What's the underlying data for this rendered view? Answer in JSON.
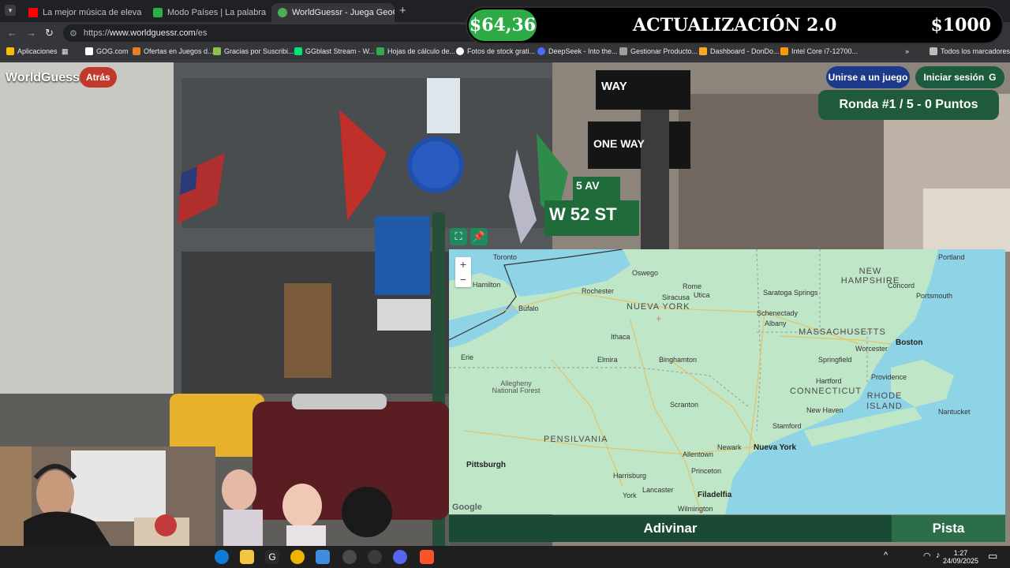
{
  "browser": {
    "tabs": [
      {
        "title": "La mejor música de elevac",
        "color": "#ff0000"
      },
      {
        "title": "Modo Países | La palabra del dí",
        "color": "#2eaa46"
      },
      {
        "title": "WorldGuessr - Juega GeoGuess",
        "color": "#4caf50"
      }
    ],
    "url_scheme": "https://",
    "url_host": "www.worldguessr.com",
    "url_path": "/es",
    "bookmarks": [
      "Aplicaciones",
      "GOG.com",
      "Ofertas en Juegos d...",
      "Gracias por Suscribi...",
      "GGblast Stream - W...",
      "Hojas de cálculo de...",
      "Fotos de stock grati...",
      "DeepSeek - Into the...",
      "Gestionar Producto...",
      "Dashboard - DonDo...",
      "Intel Core i7-12700..."
    ],
    "all_bookmarks": "Todos los marcadores"
  },
  "banner": {
    "left": "$64,36",
    "middle": "ACTUALIZACIÓN 2.0",
    "right": "$1000"
  },
  "game": {
    "logo": "WorldGuessr",
    "back": "Atrás",
    "join": "Unirse a un juego",
    "login": "Iniciar sesión",
    "login_icon": "G",
    "round": "Ronda #1 / 5 - 0 Puntos",
    "guess": "Adivinar",
    "hint": "Pista"
  },
  "street_signs": {
    "one_way": "ONE WAY",
    "way": "WAY",
    "street": "W 52 ST",
    "avenue": "5 AV"
  },
  "map": {
    "zoom_in": "+",
    "zoom_out": "−",
    "google": "Google",
    "cities": {
      "toronto": "Toronto",
      "hamilton": "Hamilton",
      "bufalo": "Búfalo",
      "rochester": "Rochester",
      "siracusa": "Siracusa",
      "albany": "Albany",
      "boston": "Boston",
      "portland": "Portland",
      "worcester": "Worcester",
      "springfield": "Springfield",
      "hartford": "Hartford",
      "providence": "Providence",
      "newyork": "Nueva York",
      "newark": "Newark",
      "scranton": "Scranton",
      "pittsburgh": "Pittsburgh",
      "erie": "Erie",
      "elmira": "Elmira",
      "binghamton": "Binghamton",
      "ithaca": "Ithaca",
      "allentown": "Allentown",
      "harrisburg": "Harrisburg",
      "filadelfia": "Filadelfia",
      "lancaster": "Lancaster",
      "york": "York",
      "wilmington": "Wilmington",
      "princeton": "Princeton",
      "stamford": "Stamford",
      "newhaven": "New Haven",
      "oswego": "Oswego",
      "rome": "Rome",
      "utica": "Utica",
      "saratoga": "Saratoga Springs",
      "schenectady": "Schenectady",
      "nantucket": "Nantucket",
      "portsmouth": "Portsmouth",
      "concord": "Concord",
      "allegheny": "Allegheny National Forest"
    },
    "states": {
      "ny": "NUEVA YORK",
      "pa": "PENSILVANIA",
      "ma": "MASSACHUSETTS",
      "ct": "CONNECTICUT",
      "ri": "RHODE ISLAND",
      "nh": "NEW HAMPSHIRE"
    }
  },
  "taskbar": {
    "time": "1:27",
    "date": "24/09/2025"
  }
}
